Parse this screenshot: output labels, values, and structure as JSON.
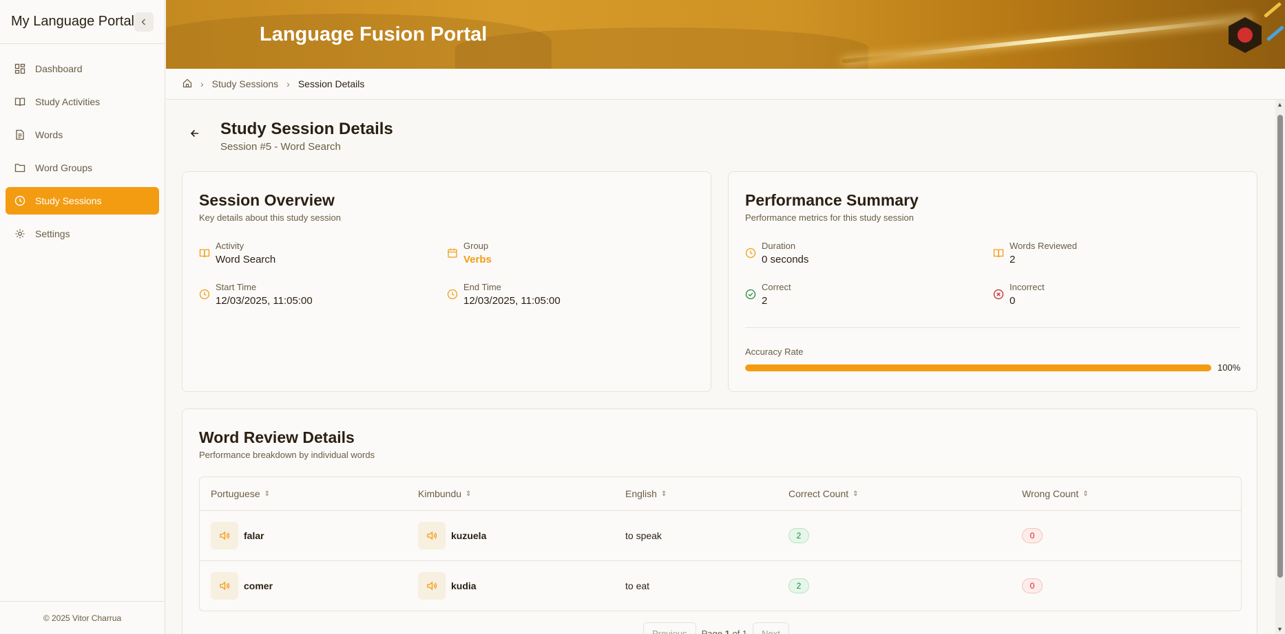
{
  "sidebar": {
    "title": "My Language Portal",
    "collapse_icon": "chevron-left-icon",
    "items": [
      {
        "label": "Dashboard",
        "icon": "dashboard-icon",
        "active": false
      },
      {
        "label": "Study Activities",
        "icon": "book-open-icon",
        "active": false
      },
      {
        "label": "Words",
        "icon": "file-text-icon",
        "active": false
      },
      {
        "label": "Word Groups",
        "icon": "folder-icon",
        "active": false
      },
      {
        "label": "Study Sessions",
        "icon": "clock-icon",
        "active": true
      },
      {
        "label": "Settings",
        "icon": "gear-icon",
        "active": false
      }
    ],
    "footer": "© 2025 Vitor Charrua"
  },
  "header": {
    "title": "Language Fusion Portal"
  },
  "breadcrumb": {
    "items": [
      "Study Sessions",
      "Session Details"
    ]
  },
  "page": {
    "title": "Study Session Details",
    "subtitle": "Session #5 - Word Search"
  },
  "overview": {
    "title": "Session Overview",
    "description": "Key details about this study session",
    "activity_label": "Activity",
    "activity_value": "Word Search",
    "group_label": "Group",
    "group_value": "Verbs",
    "start_label": "Start Time",
    "start_value": "12/03/2025, 11:05:00",
    "end_label": "End Time",
    "end_value": "12/03/2025, 11:05:00"
  },
  "performance": {
    "title": "Performance Summary",
    "description": "Performance metrics for this study session",
    "duration_label": "Duration",
    "duration_value": "0 seconds",
    "reviewed_label": "Words Reviewed",
    "reviewed_value": "2",
    "correct_label": "Correct",
    "correct_value": "2",
    "incorrect_label": "Incorrect",
    "incorrect_value": "0",
    "accuracy_label": "Accuracy Rate",
    "accuracy_value": "100%",
    "accuracy_fraction": 1.0
  },
  "review": {
    "title": "Word Review Details",
    "description": "Performance breakdown by individual words",
    "columns": [
      "Portuguese",
      "Kimbundu",
      "English",
      "Correct Count",
      "Wrong Count"
    ],
    "rows": [
      {
        "portuguese": "falar",
        "kimbundu": "kuzuela",
        "english": "to speak",
        "correct": "2",
        "wrong": "0"
      },
      {
        "portuguese": "comer",
        "kimbundu": "kudia",
        "english": "to eat",
        "correct": "2",
        "wrong": "0"
      }
    ]
  },
  "pagination": {
    "previous": "Previous",
    "page_prefix": "Page",
    "page": "1",
    "of": "of",
    "total": "1",
    "next": "Next"
  },
  "colors": {
    "accent": "#f39c12",
    "success": "#1e8a3a",
    "danger": "#c62828"
  }
}
